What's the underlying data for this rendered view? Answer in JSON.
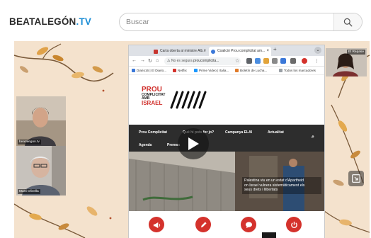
{
  "site": {
    "logo_part1": "BEATALEGÓN",
    "logo_part2": ".TV",
    "logo_color": "#1f8fd6",
    "search_placeholder": "Buscar",
    "search_icon": "search-icon"
  },
  "video": {
    "play_icon": "play-icon",
    "pip_icon": "picture-in-picture-icon",
    "participants": [
      {
        "label": "beatalegon.tv"
      },
      {
        "label": "Marti Olivella"
      },
      {
        "label": "El Repase"
      }
    ],
    "browser": {
      "tabs": [
        {
          "title": "Carta oberta al ministre Alb..."
        },
        {
          "title": "Coalició Prou complicitat am..."
        }
      ],
      "new_tab": "+",
      "address_warning": "No es segura",
      "address_url": "proucomplicita...",
      "bookmarks": [
        "Diario16 | El Diario...",
        "Netflix",
        "Prime Video | Italia...",
        "Boletín de Lucha...",
        "Todos los marcadores"
      ],
      "page": {
        "logo_line1": "PROU",
        "logo_line2": "COMPLICITAT",
        "logo_line3": "AMB",
        "logo_line4": "ISRAEL",
        "nav": [
          "Prou Complicitat",
          "Qué hi pots fer jo?",
          "Campanya ELAI",
          "Actualitat",
          "Agenda",
          "Premsa"
        ],
        "hero_caption": [
          "Palestina viu en un estat d'Apartheid",
          "on Israel vulnera sistemàticament els",
          "seus drets i llibertats"
        ],
        "accent": "#d4322c"
      }
    }
  }
}
